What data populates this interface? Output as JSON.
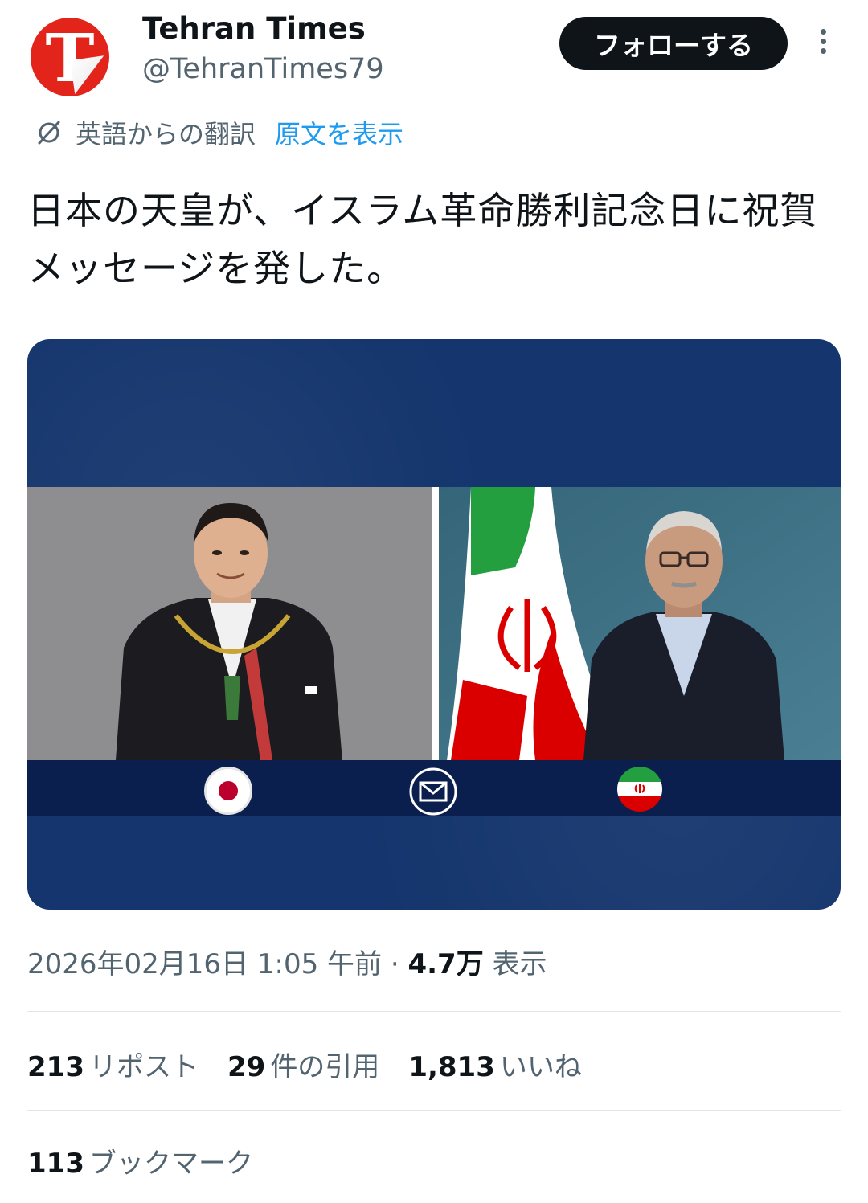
{
  "author": {
    "display_name": "Tehran Times",
    "handle": "@TehranTimes79",
    "avatar_letter": "T",
    "avatar_color": "#e3241b"
  },
  "follow_button": {
    "label": "フォローする"
  },
  "more_menu": {
    "icon": "more-vertical-icon"
  },
  "translation": {
    "icon": "translate-icon",
    "label": "英語からの翻訳",
    "show_original": "原文を表示"
  },
  "tweet": {
    "text": "日本の天皇が、イスラム革命勝利記念日に祝賀メッセージを発した。"
  },
  "media": {
    "background_color": "#14356d",
    "strip_icons": [
      "japan-flag-icon",
      "envelope-icon",
      "iran-flag-icon"
    ]
  },
  "meta": {
    "timestamp": "2026年02月16日 1:05 午前",
    "separator": " · ",
    "views_count": "4.7万",
    "views_label": "表示"
  },
  "stats": {
    "reposts": {
      "count": "213",
      "label": "リポスト"
    },
    "quotes": {
      "count": "29",
      "label": "件の引用"
    },
    "likes": {
      "count": "1,813",
      "label": "いいね"
    },
    "bookmarks": {
      "count": "113",
      "label": "ブックマーク"
    }
  },
  "colors": {
    "text_primary": "#0f1419",
    "text_secondary": "#536471",
    "link": "#1d9bf0"
  }
}
